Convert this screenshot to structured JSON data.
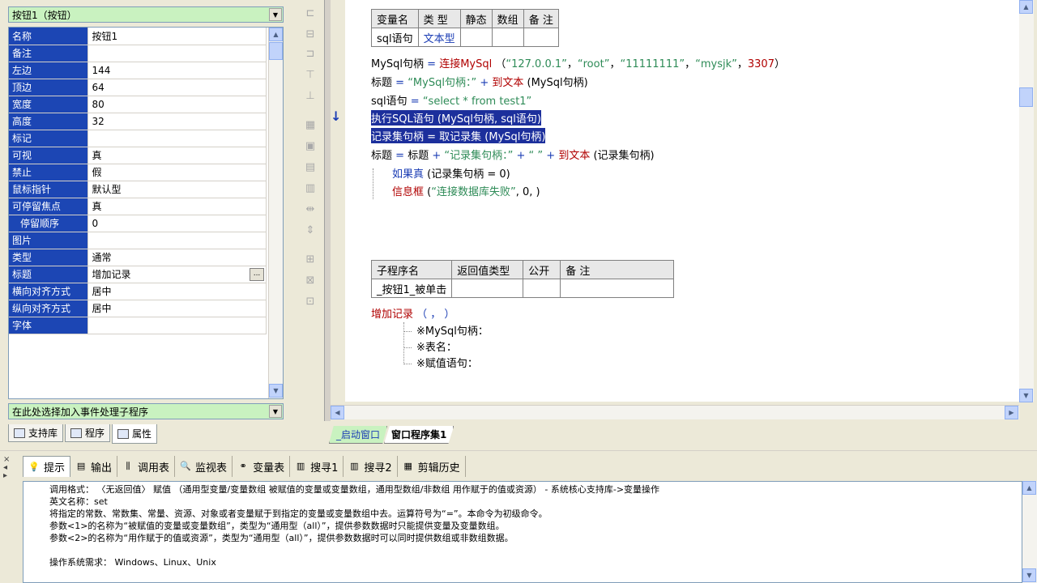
{
  "object_selector": {
    "value": "按钮1（按钮）"
  },
  "properties": [
    {
      "name": "名称",
      "value": "按钮1"
    },
    {
      "name": "备注",
      "value": ""
    },
    {
      "name": "左边",
      "value": "144"
    },
    {
      "name": "顶边",
      "value": "64"
    },
    {
      "name": "宽度",
      "value": "80"
    },
    {
      "name": "高度",
      "value": "32"
    },
    {
      "name": "标记",
      "value": ""
    },
    {
      "name": "可视",
      "value": "真"
    },
    {
      "name": "禁止",
      "value": "假"
    },
    {
      "name": "鼠标指针",
      "value": "默认型"
    },
    {
      "name": "可停留焦点",
      "value": "真"
    },
    {
      "name": "停留顺序",
      "value": "0"
    },
    {
      "name": "图片",
      "value": ""
    },
    {
      "name": "类型",
      "value": "通常"
    },
    {
      "name": "标题",
      "value": "增加记录",
      "ellipsis": "..."
    },
    {
      "name": "横向对齐方式",
      "value": "居中"
    },
    {
      "name": "纵向对齐方式",
      "value": "居中"
    },
    {
      "name": "字体",
      "value": ""
    }
  ],
  "event_selector": {
    "value": "在此处选择加入事件处理子程序"
  },
  "left_tabs": [
    {
      "label": "支持库"
    },
    {
      "label": "程序"
    },
    {
      "label": "属性"
    }
  ],
  "var_table": {
    "headers": [
      "变量名",
      "类 型",
      "静态",
      "数组",
      "备 注"
    ],
    "row": [
      "sql语句",
      "文本型",
      "",
      "",
      ""
    ]
  },
  "code_lines": {
    "l1": {
      "a": "MySql句柄",
      "b": " = ",
      "c": "连接MySql",
      "d": " （",
      "e": "“127.0.0.1”",
      "f": "，",
      "g": "“root”",
      "h": "，",
      "i": "“11111111”",
      "j": "，",
      "k": "“mysjk”",
      "l": "，",
      "m": "3307",
      "n": "）"
    },
    "l2": {
      "a": "标题",
      "b": " = ",
      "c": "“MySql句柄：”",
      "d": " + ",
      "e": "到文本",
      "f": " (MySql句柄)"
    },
    "l3": {
      "a": "sql语句",
      "b": " = ",
      "c": "“select * from test1”"
    },
    "l4": {
      "text": "执行SQL语句 (MySql句柄, sql语句)"
    },
    "l5": {
      "text": "记录集句柄 = 取记录集 (MySql句柄)"
    },
    "l6": {
      "a": "标题",
      "b": " = ",
      "c": "标题",
      "d": " + ",
      "e": "“记录集句柄：”",
      "f": " + ",
      "g": "“ ”",
      "h": " + ",
      "i": "到文本",
      "j": " (记录集句柄)"
    },
    "l7": {
      "a": "如果真",
      "b": " (记录集句柄 = 0)"
    },
    "l8": {
      "a": "信息框",
      "b": " (",
      "c": "“连接数据库失败”",
      "d": ", 0, )"
    }
  },
  "sub_table": {
    "headers": [
      "子程序名",
      "返回值类型",
      "公开",
      "备 注"
    ],
    "row": [
      "_按钮1_被单击",
      "",
      "",
      ""
    ]
  },
  "call_line": {
    "name": "增加记录",
    "args": " （ ， ）"
  },
  "params": [
    "※MySql句柄：",
    "※表名：",
    "※赋值语句："
  ],
  "editor_tabs": [
    {
      "label": "_启动窗口"
    },
    {
      "label": "窗口程序集1"
    }
  ],
  "bottom_tabs": [
    {
      "label": "提示",
      "icon": "lightbulb-icon"
    },
    {
      "label": "输出",
      "icon": "output-icon"
    },
    {
      "label": "调用表",
      "icon": "call-table-icon"
    },
    {
      "label": "监视表",
      "icon": "watch-icon"
    },
    {
      "label": "变量表",
      "icon": "variable-icon"
    },
    {
      "label": "搜寻1",
      "icon": "search1-icon"
    },
    {
      "label": "搜寻2",
      "icon": "search2-icon"
    },
    {
      "label": "剪辑历史",
      "icon": "clip-history-icon"
    }
  ],
  "output_lines": [
    "调用格式： 〈无返回值〉 赋值 （通用型变量/变量数组 被赋值的变量或变量数组，通用型数组/非数组 用作赋于的值或资源） - 系统核心支持库->变量操作",
    "英文名称：set",
    "将指定的常数、常数集、常量、资源、对象或者变量赋于到指定的变量或变量数组中去。运算符号为“=”。本命令为初级命令。",
    "参数<1>的名称为“被赋值的变量或变量数组”，类型为“通用型（all）”，提供参数数据时只能提供变量及变量数组。",
    "参数<2>的名称为“用作赋于的值或资源”，类型为“通用型（all）”，提供参数数据时可以同时提供数组或非数组数据。",
    "",
    "操作系统需求： Windows、Linux、Unix"
  ]
}
